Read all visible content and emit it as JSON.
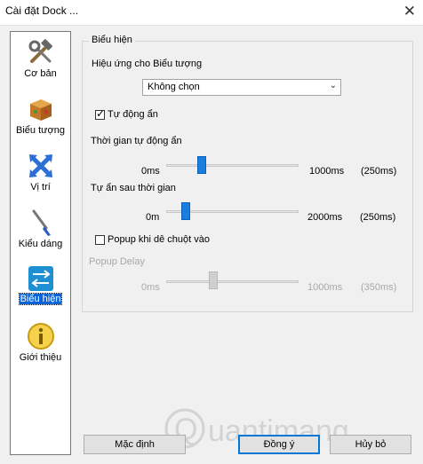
{
  "window": {
    "title": "Cài đặt Dock ...",
    "close_glyph": "✕"
  },
  "sidebar": {
    "items": [
      {
        "label": "Cơ bản",
        "icon": "tools-icon"
      },
      {
        "label": "Biểu tượng",
        "icon": "box-icon"
      },
      {
        "label": "Vị trí",
        "icon": "arrows-icon"
      },
      {
        "label": "Kiểu dáng",
        "icon": "brush-icon"
      },
      {
        "label": "Biểu hiện",
        "icon": "swap-arrows-icon",
        "active": true
      },
      {
        "label": "Giới thiệu",
        "icon": "info-icon"
      }
    ]
  },
  "group": {
    "title": "Biểu hiện"
  },
  "icon_effect": {
    "label": "Hiệu ứng cho Biểu tượng",
    "value": "Không chọn"
  },
  "autohide": {
    "label": "Tự động ẩn",
    "checked": true
  },
  "autohide_time": {
    "label": "Thời gian tự động ẩn",
    "min": "0ms",
    "max": "1000ms",
    "value": "(250ms)",
    "fraction": 0.25
  },
  "hide_after": {
    "label": "Tự ẩn sau thời gian",
    "min": "0m",
    "max": "2000ms",
    "value": "(250ms)",
    "fraction": 0.125
  },
  "popup": {
    "label": "Popup khi dê chuột vào",
    "checked": false
  },
  "popup_delay": {
    "label": "Popup Delay",
    "min": "0ms",
    "max": "1000ms",
    "value": "(350ms)",
    "fraction": 0.35
  },
  "buttons": {
    "defaults": "Mặc định",
    "ok": "Đồng ý",
    "cancel": "Hủy bỏ"
  },
  "watermark": {
    "text": "uantimang",
    "letter": "Q"
  },
  "colors": {
    "accent": "#0a64d8",
    "slider": "#1a7ee0"
  }
}
